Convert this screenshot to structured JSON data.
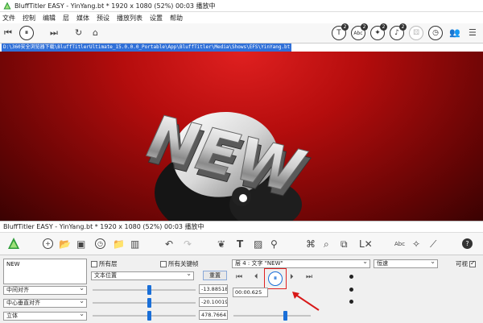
{
  "window": {
    "title": "BluffTitler EASY  - YinYang.bt * 1920 x 1080 (52%) 00:03 播放中"
  },
  "menu": [
    "文件",
    "控制",
    "编辑",
    "层",
    "媒体",
    "预设",
    "播放列表",
    "设置",
    "帮助"
  ],
  "toolbar": {
    "badges": [
      "2",
      "2",
      "2",
      "2"
    ],
    "right_icons": [
      "text-layer-icon",
      "text-abc-icon",
      "effects-icon",
      "media-icon",
      "dice-icon",
      "timer-icon",
      "users-icon",
      "menu-icon"
    ]
  },
  "path": {
    "text": "D:\\360安全浏览器下载\\BluffTitlerUltimate_15.0.0.0_Portable\\App\\BluffTitler\\Media\\Shows\\EFS\\YinYang.bt"
  },
  "scene": {
    "text": "NEW",
    "colors": {
      "bg_top": "#e02020",
      "bg_bottom": "#3a0202"
    }
  },
  "panel": {
    "title": "BluffTitler EASY  - YinYang.bt * 1920 x 1080 (52%) 00:03 播放中",
    "text_value": "NEW",
    "all_layers_label": "所有层",
    "all_keyframes_label": "所有关键帧",
    "layer_select": "层 4 : 文字 \"NEW\"",
    "easing_select": "恒速",
    "visible_label": "可视",
    "property_select": "文本位置",
    "reset_label": "重置",
    "align_h": "中间对齐",
    "align_v": "中心垂直对齐",
    "mode": "立体",
    "values": [
      "-13.88518",
      "-20.10019",
      "478.76641"
    ],
    "time": "00:00.625",
    "slider_levels": [
      0.55,
      0.55,
      0.55
    ]
  }
}
